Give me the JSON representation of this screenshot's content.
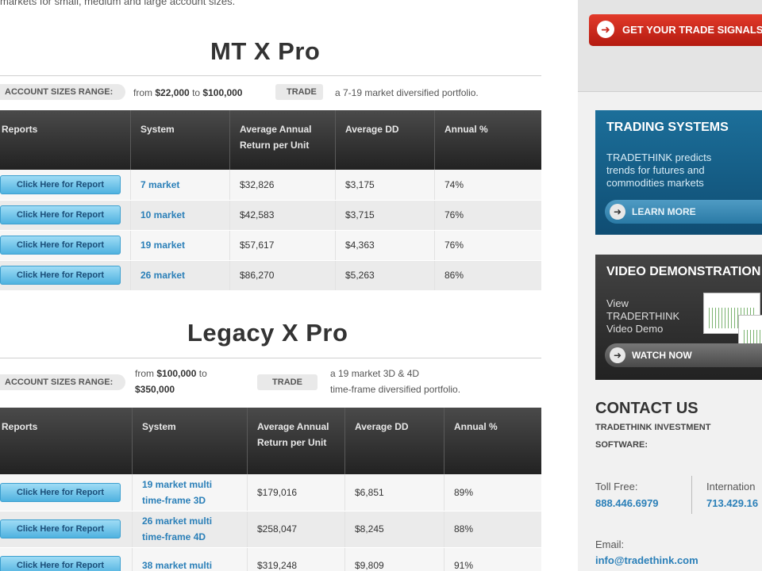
{
  "top_note": "markets for small, medium and large account sizes.",
  "mt": {
    "title": "MT X Pro",
    "range_label": "ACCOUNT SIZES RANGE:",
    "range_from": "from ",
    "range_low": "$22,000",
    "range_to": " to ",
    "range_high": "$100,000",
    "trade_label": "TRADE",
    "trade_desc": "a 7-19 market diversified portfolio.",
    "columns": [
      "Reports",
      "System",
      "Average Annual Return per Unit",
      "Average DD",
      "Annual %"
    ],
    "button_label": "Click Here for Report",
    "rows": [
      {
        "system": "7 market",
        "return": "$32,826",
        "dd": "$3,175",
        "annual": "74%"
      },
      {
        "system": "10 market",
        "return": "$42,583",
        "dd": "$3,715",
        "annual": "76%"
      },
      {
        "system": "19 market",
        "return": "$57,617",
        "dd": "$4,363",
        "annual": "76%"
      },
      {
        "system": "26 market",
        "return": "$86,270",
        "dd": "$5,263",
        "annual": "86%"
      }
    ]
  },
  "legacy": {
    "title": "Legacy X Pro",
    "range_label": "ACCOUNT SIZES RANGE:",
    "range_from": "from ",
    "range_low": "$100,000",
    "range_to": " to",
    "range_high": "$350,000",
    "trade_label": "TRADE",
    "trade_desc_1": "a 19 market 3D & 4D",
    "trade_desc_2": "time-frame diversified portfolio.",
    "columns": [
      "Reports",
      "System",
      "Average Annual Return per Unit",
      "Average DD",
      "Annual %"
    ],
    "button_label": "Click Here for Report",
    "rows": [
      {
        "system_1": "19 market multi",
        "system_2": "time-frame 3D",
        "return": "$179,016",
        "dd": "$6,851",
        "annual": "89%"
      },
      {
        "system_1": "26 market multi",
        "system_2": "time-frame 4D",
        "return": "$258,047",
        "dd": "$8,245",
        "annual": "88%"
      },
      {
        "system_1": "38 market multi",
        "system_2": "",
        "return": "$319,248",
        "dd": "$9,809",
        "annual": "91%"
      }
    ]
  },
  "sidebar": {
    "signals_button": "GET YOUR TRADE SIGNALS",
    "trading": {
      "title": "TRADING SYSTEMS",
      "body_1": "TRADETHINK predicts",
      "body_2": "trends for futures and",
      "body_3": "commodities markets",
      "button": "LEARN MORE"
    },
    "video": {
      "title": "VIDEO DEMONSTRATION",
      "body_1": "View",
      "body_2": "TRADERTHINK",
      "body_3": "Video Demo",
      "button": "WATCH NOW"
    },
    "contact": {
      "title": "CONTACT US",
      "sub_1": "TRADETHINK INVESTMENT",
      "sub_2": "SOFTWARE:",
      "toll_label": "Toll Free:",
      "toll_value": "888.446.6979",
      "intl_label": "Internation",
      "intl_value": "713.429.16",
      "email_label": "Email:",
      "email_value": "info@tradethink.com"
    }
  },
  "colors": {
    "accent_blue": "#2a7fb8",
    "signal_red": "#c8251a",
    "header_dark": "#2a2a2a"
  }
}
